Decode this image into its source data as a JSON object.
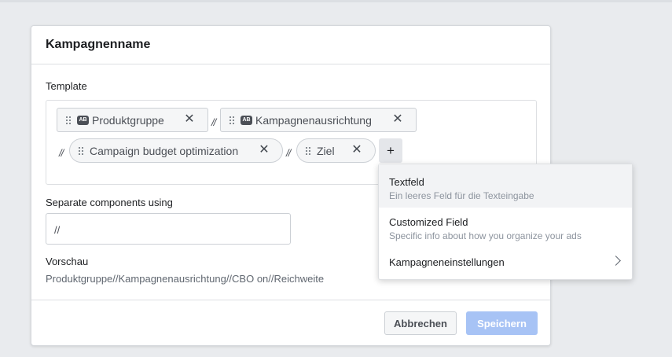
{
  "modal": {
    "title": "Kampagnenname",
    "template_label": "Template",
    "chips": [
      {
        "label": "Produktgruppe",
        "type_badge": "AB",
        "icon": "text-type-icon"
      },
      {
        "label": "Kampagnenausrichtung",
        "type_badge": "AB",
        "icon": "text-type-icon"
      },
      {
        "label": "Campaign budget optimization"
      },
      {
        "label": "Ziel"
      }
    ],
    "separator": "//",
    "add_button": "+",
    "separate_label": "Separate components using",
    "separate_value": "//",
    "preview_label": "Vorschau",
    "preview_value": "Produktgruppe//Kampagnenausrichtung//CBO on//Reichweite",
    "cancel_label": "Abbrechen",
    "save_label": "Speichern"
  },
  "dropdown": {
    "items": [
      {
        "title": "Textfeld",
        "desc": "Ein leeres Feld für die Texteingabe"
      },
      {
        "title": "Customized Field",
        "desc": "Specific info about how you organize your ads"
      },
      {
        "title": "Kampagneneinstellungen"
      }
    ]
  },
  "colors": {
    "background": "#e9ebee",
    "save_disabled": "#a7c3f5",
    "text_primary": "#1c1e21",
    "text_secondary": "#606770"
  }
}
